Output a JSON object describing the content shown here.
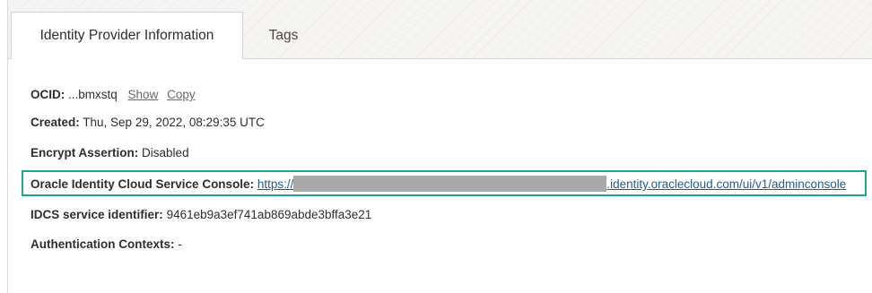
{
  "tabs": [
    {
      "label": "Identity Provider Information",
      "active": true
    },
    {
      "label": "Tags",
      "active": false
    }
  ],
  "details": {
    "ocid": {
      "label": "OCID:",
      "value": "...bmxstq",
      "show_link": "Show",
      "copy_link": "Copy"
    },
    "created": {
      "label": "Created:",
      "value": "Thu, Sep 29, 2022, 08:29:35 UTC"
    },
    "encrypt_assertion": {
      "label": "Encrypt Assertion:",
      "value": "Disabled"
    },
    "console": {
      "label": "Oracle Identity Cloud Service Console:",
      "url_prefix": "https://",
      "url_suffix": ".identity.oraclecloud.com/ui/v1/adminconsole"
    },
    "idcs_identifier": {
      "label": "IDCS service identifier:",
      "value": "9461eb9a3ef741ab869abde3bffa3e21"
    },
    "auth_contexts": {
      "label": "Authentication Contexts:",
      "value": "-"
    }
  },
  "colors": {
    "highlight_border": "#1fa58b",
    "link": "#1e5c94",
    "redaction": "#a9a9a9"
  }
}
